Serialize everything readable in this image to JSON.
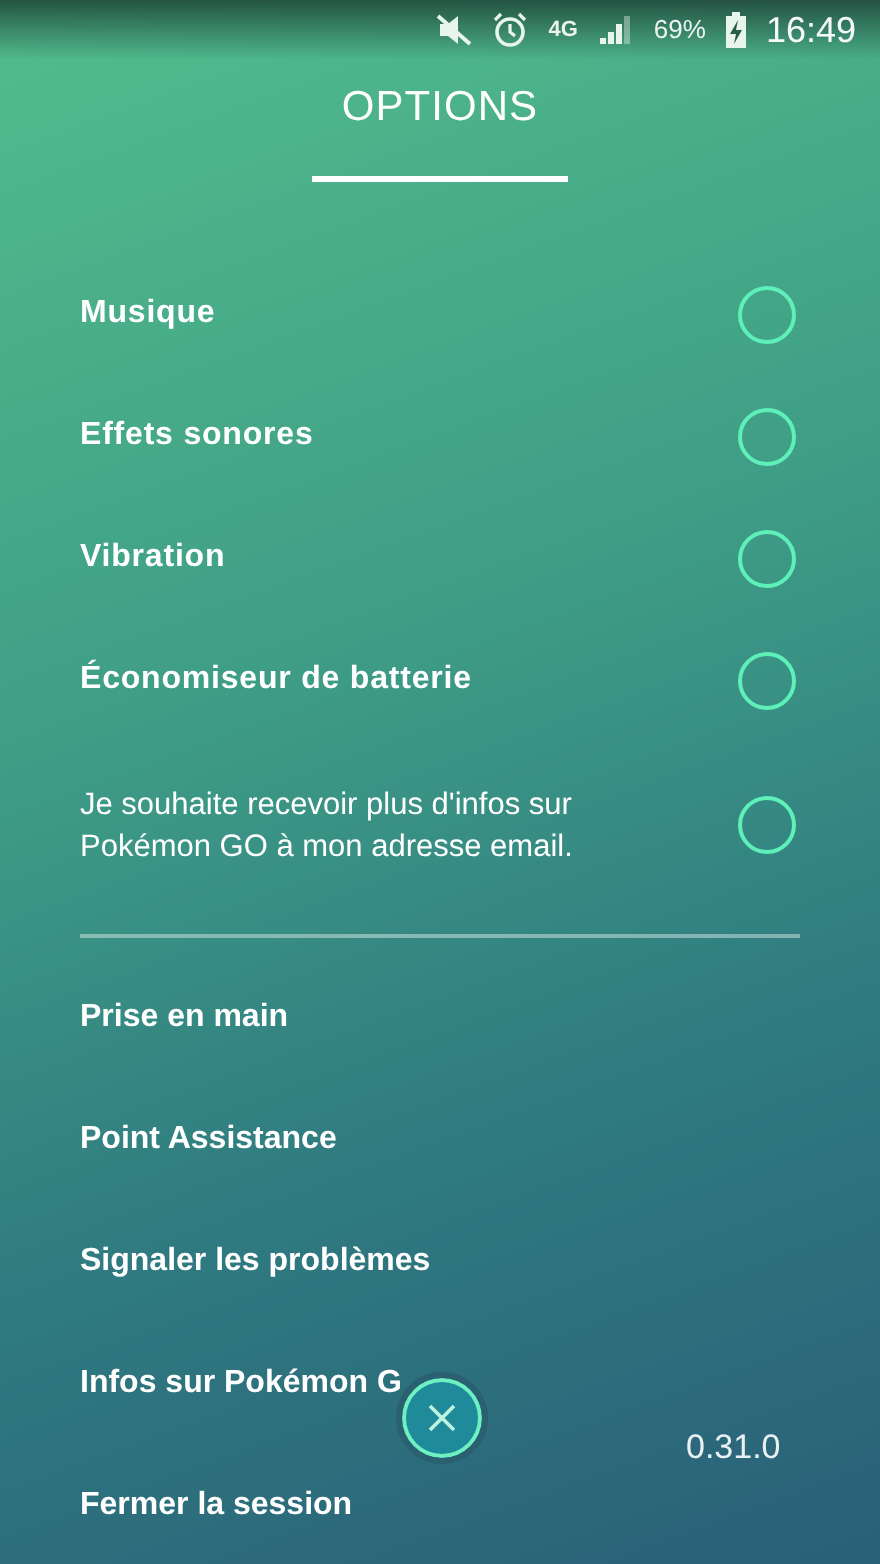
{
  "status_bar": {
    "network": "4G",
    "battery": "69%",
    "time": "16:49"
  },
  "title": "OPTIONS",
  "toggles": [
    {
      "label": "Musique",
      "checked": false
    },
    {
      "label": "Effets sonores",
      "checked": false
    },
    {
      "label": "Vibration",
      "checked": false
    },
    {
      "label": "Économiseur de batterie",
      "checked": false
    },
    {
      "label": "Je souhaite recevoir plus d'infos sur Pokémon GO à mon adresse email.",
      "checked": false,
      "kind": "paragraph"
    }
  ],
  "links": [
    "Prise en main",
    "Point Assistance",
    "Signaler les problèmes",
    "Infos sur Pokémon G",
    "Fermer la session"
  ],
  "version": "0.31.0"
}
